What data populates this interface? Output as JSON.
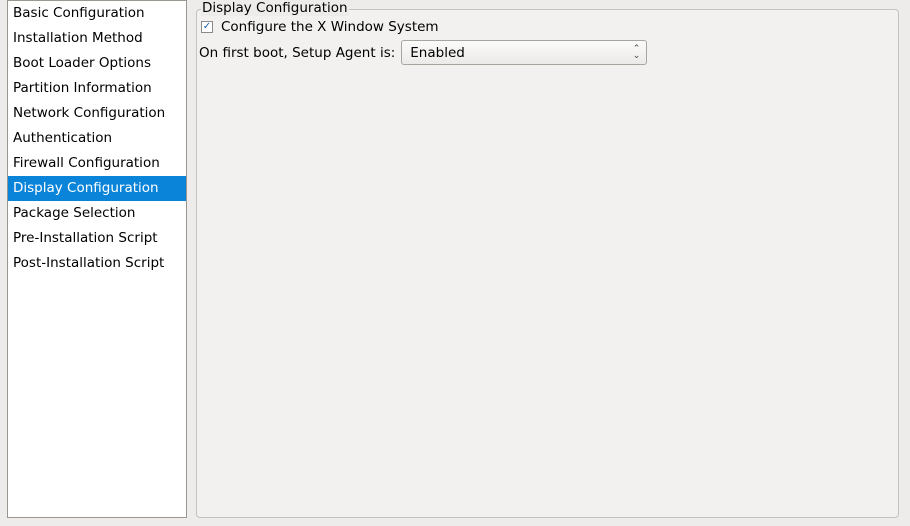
{
  "sidebar": {
    "items": [
      "Basic Configuration",
      "Installation Method",
      "Boot Loader Options",
      "Partition Information",
      "Network Configuration",
      "Authentication",
      "Firewall Configuration",
      "Display Configuration",
      "Package Selection",
      "Pre-Installation Script",
      "Post-Installation Script"
    ],
    "selected": "Display Configuration"
  },
  "panel": {
    "title": "Display Configuration",
    "configure_x_label": "Configure the X Window System",
    "configure_x_checked": true,
    "agent_label": "On first boot, Setup Agent is:",
    "agent_value": "Enabled"
  }
}
